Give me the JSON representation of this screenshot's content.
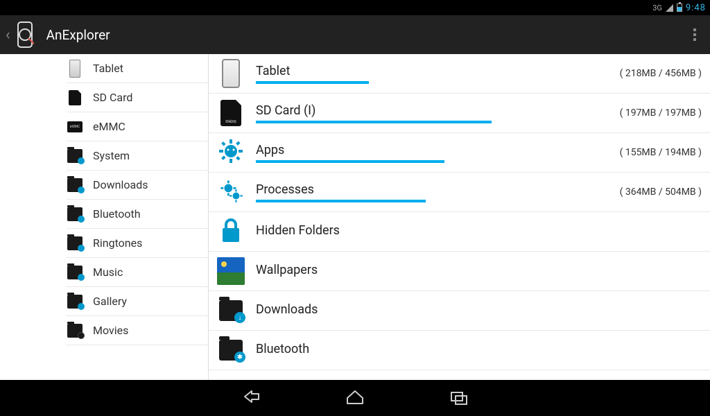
{
  "status": {
    "net": "3G",
    "clock": "9:48"
  },
  "header": {
    "title": "AnExplorer"
  },
  "accent": "#00aeef",
  "sidebar": {
    "items": [
      {
        "label": "Tablet",
        "icon": "tablet"
      },
      {
        "label": "SD Card",
        "icon": "sdcard"
      },
      {
        "label": "eMMC",
        "icon": "emmc"
      },
      {
        "label": "System",
        "icon": "folder-gear"
      },
      {
        "label": "Downloads",
        "icon": "folder-down"
      },
      {
        "label": "Bluetooth",
        "icon": "folder-bt"
      },
      {
        "label": "Ringtones",
        "icon": "folder-note"
      },
      {
        "label": "Music",
        "icon": "folder-note"
      },
      {
        "label": "Gallery",
        "icon": "folder-pic"
      },
      {
        "label": "Movies",
        "icon": "folder-mov"
      }
    ]
  },
  "main": {
    "items": [
      {
        "label": "Tablet",
        "icon": "tablet",
        "used": 218,
        "total": 456,
        "unit": "MB"
      },
      {
        "label": "SD Card (I)",
        "icon": "sdcard",
        "used": 197,
        "total": 197,
        "unit": "MB"
      },
      {
        "label": "Apps",
        "icon": "apps-gear",
        "used": 155,
        "total": 194,
        "unit": "MB"
      },
      {
        "label": "Processes",
        "icon": "proc-gears",
        "used": 364,
        "total": 504,
        "unit": "MB"
      },
      {
        "label": "Hidden Folders",
        "icon": "lock"
      },
      {
        "label": "Wallpapers",
        "icon": "wallpaper"
      },
      {
        "label": "Downloads",
        "icon": "folder-down"
      },
      {
        "label": "Bluetooth",
        "icon": "folder-bt"
      }
    ]
  }
}
